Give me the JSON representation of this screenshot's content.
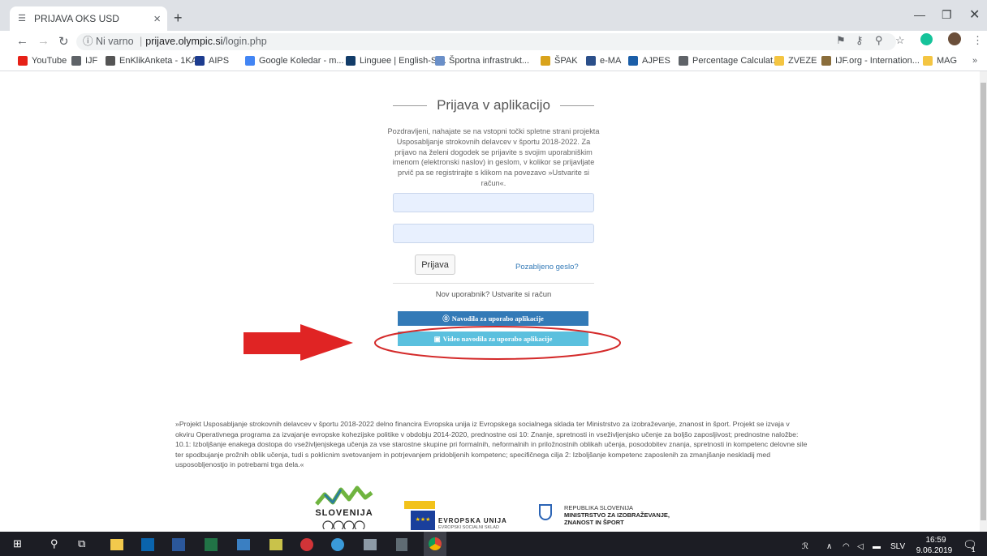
{
  "browser": {
    "tab_title": "PRIJAVA OKS USD",
    "url_security": "Ni varno",
    "url_separator": "|",
    "url_host": "prijave.olympic.si",
    "url_path": "/login.php",
    "bookmarks": [
      {
        "label": "YouTube",
        "color": "#e62117"
      },
      {
        "label": "IJF",
        "color": "#5f6368"
      },
      {
        "label": "EnKlikAnketa - 1KA...",
        "color": "#555555"
      },
      {
        "label": "AIPS",
        "color": "#1d3c8f"
      },
      {
        "label": "Google Koledar - m...",
        "color": "#4285f4"
      },
      {
        "label": "Linguee | English-Sl...",
        "color": "#123c69"
      },
      {
        "label": "Športna infrastrukt...",
        "color": "#6a8fc8"
      },
      {
        "label": "ŠPAK",
        "color": "#d9a31b"
      },
      {
        "label": "e-MA",
        "color": "#2b4f8a"
      },
      {
        "label": "AJPES",
        "color": "#1b5ea8"
      },
      {
        "label": "Percentage Calculat...",
        "color": "#5f6368"
      },
      {
        "label": "ZVEZE",
        "color": "#f4c542"
      },
      {
        "label": "IJF.org - Internation...",
        "color": "#8a6d3b"
      },
      {
        "label": "MAG",
        "color": "#f4c542"
      }
    ]
  },
  "page": {
    "title": "Prijava v aplikacijo",
    "intro": "Pozdravljeni, nahajate se na vstopni točki spletne strani projekta Usposabljanje strokovnih delavcev v športu 2018-2022. Za prijavo na želeni dogodek se prijavite s svojim uporabniškim imenom (elektronski naslov) in geslom, v kolikor se prijavljate prvič pa se registrirajte s klikom na povezavo »Ustvarite si račun«.",
    "login_button": "Prijava",
    "forgot_link": "Pozabljeno geslo?",
    "new_user_link": "Nov uporabnik? Ustvarite si račun",
    "instructions_button": "Navodila za uporabo aplikacije",
    "video_button": "Video navodila za uporabo aplikacije",
    "footer_text": "»Projekt Usposabljanje strokovnih delavcev v športu 2018-2022 delno financira Evropska unija iz Evropskega socialnega sklada ter Ministrstvo za izobraževanje, znanost in šport. Projekt se izvaja v okviru Operativnega programa za izvajanje evropske kohezijske politike v obdobju 2014-2020, prednostne osi 10: Znanje, spretnosti in vseživljenjsko učenje za boljšo zaposljivost; prednostne naložbe: 10.1: Izboljšanje enakega dostopa do vseživljenjskega učenja za vse starostne skupine pri formalnih, neformalnih in priložnostnih oblikah učenja, posodobitev znanja, spretnosti in kompetenc delovne sile ter spodbujanje prožnih oblik učenja, tudi s poklicnim svetovanjem in potrjevanjem pridobljenih kompetenc; specifičnega cilja 2: Izboljšanje kompetenc zaposlenih za zmanjšanje neskladij med usposobljenostjo in potrebami trga dela.«",
    "logo_slovenija": "SLOVENIJA",
    "logo_eu_line1": "EVROPSKA UNIJA",
    "logo_eu_line2": "EVROPSKI SOCIALNI SKLAD",
    "logo_gov_line1": "REPUBLIKA SLOVENIJA",
    "logo_gov_line2": "MINISTRSTVO ZA IZOBRAŽEVANJE,",
    "logo_gov_line3": "ZNANOST IN ŠPORT"
  },
  "taskbar": {
    "language": "SLV",
    "time": "16:59",
    "date": "9.06.2019",
    "notification_count": "1"
  },
  "colors": {
    "primary_button": "#337ab7",
    "info_button": "#5bc0de",
    "annotation_red": "#e02424",
    "input_fill": "#e8f0fe"
  }
}
